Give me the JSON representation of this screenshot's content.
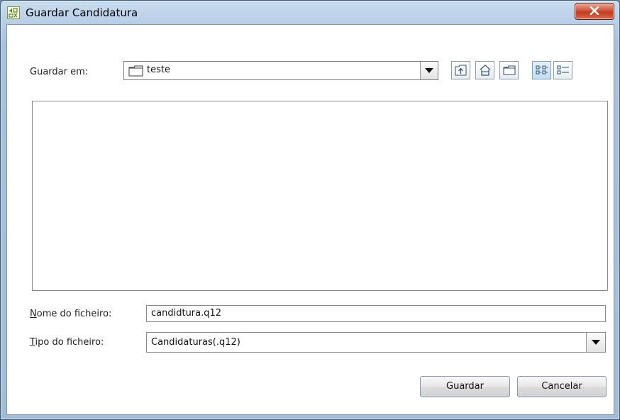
{
  "window": {
    "title": "Guardar Candidatura"
  },
  "save_in": {
    "label": "Guardar em:",
    "value": "teste"
  },
  "filename": {
    "label_mnemonic": "N",
    "label_rest": "ome do ficheiro:",
    "value": "candidtura.q12"
  },
  "filetype": {
    "label_mnemonic": "T",
    "label_rest": "ipo do ficheiro:",
    "value": "Candidaturas(.q12)"
  },
  "buttons": {
    "save": "Guardar",
    "cancel": "Cancelar"
  },
  "toolbar": {
    "icons": [
      "up-folder-icon",
      "home-icon",
      "new-folder-icon",
      "list-view-icon",
      "details-view-icon"
    ],
    "active": "list-view-icon"
  },
  "colors": {
    "title_gradient_top": "#c9dcef",
    "close_red": "#c13b20",
    "active_toggle": "#c4dcf2"
  }
}
